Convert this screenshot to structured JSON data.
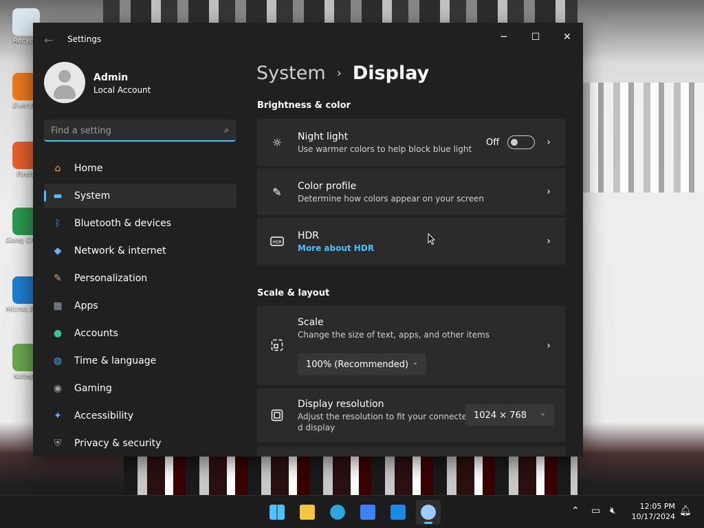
{
  "desktop": {
    "icons": [
      {
        "label": "Recycle",
        "color": "#d9e7f0"
      },
      {
        "label": "Everyth",
        "color": "#f07a1c"
      },
      {
        "label": "Firefo",
        "color": "#e8612c"
      },
      {
        "label": "Goog Chrom",
        "color": "#2b9a4f"
      },
      {
        "label": "Micros Edge",
        "color": "#1e7fd0"
      },
      {
        "label": "Notepa",
        "color": "#6aa84f"
      }
    ]
  },
  "window": {
    "title": "Settings",
    "controls": {
      "minimize": "─",
      "maximize": "☐",
      "close": "✕"
    }
  },
  "account": {
    "name": "Admin",
    "type": "Local Account"
  },
  "search": {
    "placeholder": "Find a setting"
  },
  "nav": [
    {
      "label": "Home",
      "icon": "home-icon",
      "glyph": "⌂",
      "color": "#f2a25b"
    },
    {
      "label": "System",
      "icon": "system-icon",
      "glyph": "▬",
      "color": "#4cc2ff",
      "active": true
    },
    {
      "label": "Bluetooth & devices",
      "icon": "bluetooth-icon",
      "glyph": "ᛒ",
      "color": "#3a8ee6"
    },
    {
      "label": "Network & internet",
      "icon": "wifi-icon",
      "glyph": "◆",
      "color": "#5fb8ff"
    },
    {
      "label": "Personalization",
      "icon": "brush-icon",
      "glyph": "✎",
      "color": "#d8a070"
    },
    {
      "label": "Apps",
      "icon": "apps-icon",
      "glyph": "▦",
      "color": "#9aa3b5"
    },
    {
      "label": "Accounts",
      "icon": "accounts-icon",
      "glyph": "●",
      "color": "#3cc39a"
    },
    {
      "label": "Time & language",
      "icon": "globe-icon",
      "glyph": "◍",
      "color": "#45a8f5"
    },
    {
      "label": "Gaming",
      "icon": "gamepad-icon",
      "glyph": "◉",
      "color": "#a0a0a0"
    },
    {
      "label": "Accessibility",
      "icon": "accessibility-icon",
      "glyph": "✦",
      "color": "#5bb3ff"
    },
    {
      "label": "Privacy & security",
      "icon": "shield-icon",
      "glyph": "⛨",
      "color": "#a6a6a6"
    }
  ],
  "breadcrumb": {
    "parent": "System",
    "separator": "›",
    "current": "Display"
  },
  "sections": {
    "brightness": "Brightness & color",
    "scale": "Scale & layout"
  },
  "cards": {
    "night_light": {
      "title": "Night light",
      "desc": "Use warmer colors to help block blue light",
      "toggle_label": "Off",
      "toggle_on": false,
      "icon": "sun-icon"
    },
    "color_profile": {
      "title": "Color profile",
      "desc": "Determine how colors appear on your screen",
      "icon": "pen-icon"
    },
    "hdr": {
      "title": "HDR",
      "link": "More about HDR",
      "icon": "hdr-icon"
    },
    "scale": {
      "title": "Scale",
      "desc": "Change the size of text, apps, and other items",
      "value": "100% (Recommended)",
      "icon": "scale-icon"
    },
    "resolution": {
      "title": "Display resolution",
      "desc_line1": "Adjust the resolution to fit your connecte",
      "desc_line2": "d display",
      "value": "1024 × 768",
      "icon": "resolution-icon"
    }
  },
  "taskbar": {
    "apps": [
      {
        "name": "start-icon",
        "color": "#4cc2ff"
      },
      {
        "name": "file-explorer-icon",
        "color": "#f5c542"
      },
      {
        "name": "edge-icon",
        "color": "#2aa6e0"
      },
      {
        "name": "store-icon",
        "color": "#3b82f6"
      },
      {
        "name": "outlook-icon",
        "color": "#1e88e5"
      },
      {
        "name": "settings-icon",
        "color": "#9ecbff",
        "active": true
      }
    ],
    "clock": {
      "time": "12:05 PM",
      "date": "10/17/2024"
    }
  }
}
